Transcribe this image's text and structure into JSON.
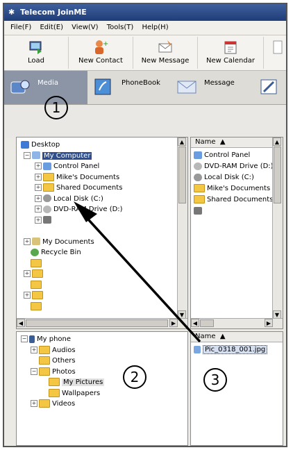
{
  "window": {
    "title": "Telecom JoinME"
  },
  "menu": [
    "File(F)",
    "Edit(E)",
    "View(V)",
    "Tools(T)",
    "Help(H)"
  ],
  "toolbar": [
    {
      "label": "Load",
      "icon": "load-icon"
    },
    {
      "label": "New Contact",
      "icon": "new-contact-icon"
    },
    {
      "label": "New Message",
      "icon": "new-message-icon"
    },
    {
      "label": "New Calendar",
      "icon": "new-calendar-icon"
    }
  ],
  "nav": [
    {
      "label": "Media",
      "icon": "media-icon",
      "active": true
    },
    {
      "label": "PhoneBook",
      "icon": "phonebook-icon"
    },
    {
      "label": "Message",
      "icon": "message-icon"
    }
  ],
  "computer_tree": {
    "desktop": "Desktop",
    "my_computer": "My Computer",
    "control_panel": "Control Panel",
    "mikes_documents": "Mike's Documents",
    "shared_documents": "Shared Documents",
    "local_disk": "Local Disk (C:)",
    "dvd_drive": "DVD-RAM Drive (D:)",
    "my_documents": "My Documents",
    "recycle_bin": "Recycle Bin"
  },
  "computer_list": {
    "header": "Name",
    "items": [
      "Control Panel",
      "DVD-RAM Drive (D:)",
      "Local Disk (C:)",
      "Mike's Documents",
      "Shared Documents"
    ]
  },
  "phone_tree": {
    "my_phone": "My phone",
    "audios": "Audios",
    "others": "Others",
    "photos": "Photos",
    "my_pictures": "My Pictures",
    "wallpapers": "Wallpapers",
    "videos": "Videos"
  },
  "phone_list": {
    "header": "Name",
    "items": [
      "Pic_0318_001.jpg"
    ]
  },
  "callouts": {
    "one": "1",
    "two": "2",
    "three": "3"
  }
}
